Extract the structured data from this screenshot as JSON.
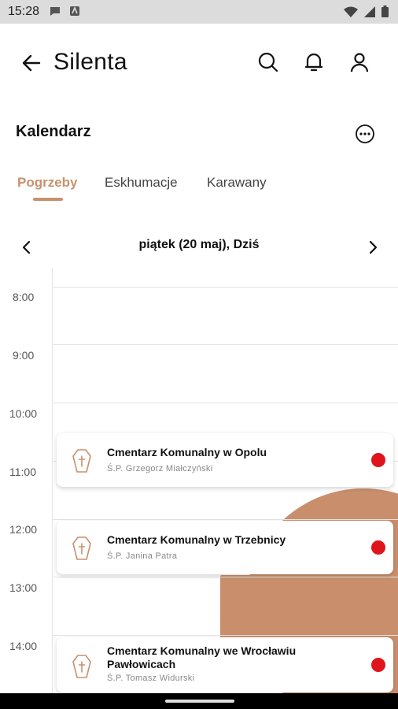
{
  "statusbar": {
    "time": "15:28"
  },
  "appbar": {
    "title": "Silenta",
    "icons": [
      "back-arrow-icon",
      "search-icon",
      "bell-icon",
      "user-icon"
    ]
  },
  "section": {
    "title": "Kalendarz",
    "menu_icon": "more-dots-icon"
  },
  "tabs": [
    {
      "label": "Pogrzeby",
      "active": true
    },
    {
      "label": "Eskhumacje",
      "active": false
    },
    {
      "label": "Karawany",
      "active": false
    }
  ],
  "date": {
    "label": "piątek (20 maj), Dziś"
  },
  "times": [
    "8:00",
    "9:00",
    "10:00",
    "11:00",
    "12:00",
    "13:00",
    "14:00"
  ],
  "events": [
    {
      "title": "Cmentarz Komunalny w Opolu",
      "subtitle": "Ś.P. Grzegorz Miałczyński",
      "status_color": "#e0141c"
    },
    {
      "title": "Cmentarz Komunalny w Trzebnicy",
      "subtitle": "Ś.P. Janina Patra",
      "status_color": "#e0141c"
    },
    {
      "title": "Cmentarz Komunalny we Wrocławiu Pawłowicach",
      "subtitle": "Ś.P. Tomasz Widurski",
      "status_color": "#e0141c"
    }
  ],
  "colors": {
    "accent": "#c9906e",
    "status": "#e0141c"
  }
}
